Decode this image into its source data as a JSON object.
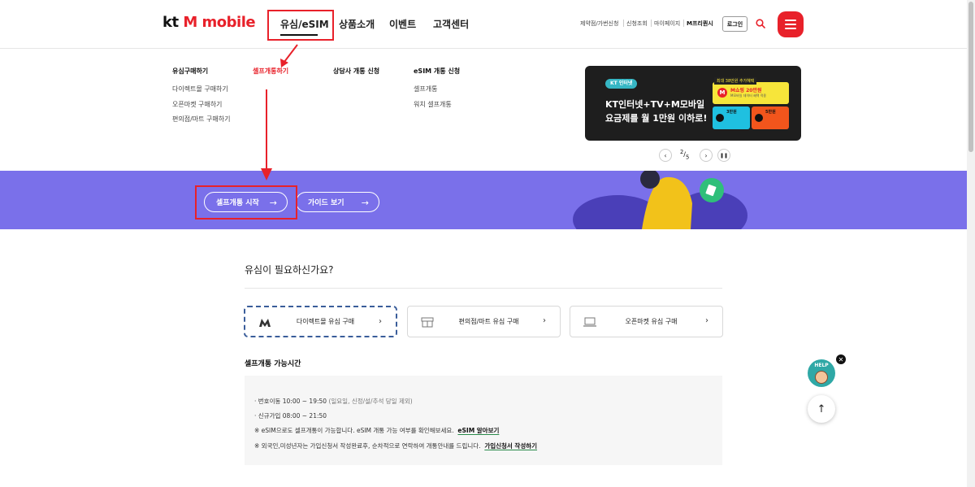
{
  "header": {
    "logo_kt": "kt",
    "logo_brand": "M mobile",
    "gnb": [
      "유심/eSIM",
      "상품소개",
      "이벤트",
      "고객센터"
    ],
    "util": [
      "제약점/가번신청",
      "신청조회",
      "마이페이지",
      "M프리퀀시"
    ],
    "login_label": "로그인"
  },
  "mega_menu": {
    "col1_title": "유심구매하기",
    "col1_items": [
      "다이렉트몰 구매하기",
      "오픈마켓 구매하기",
      "편의점/마트 구매하기"
    ],
    "col2_title": "셀프개통하기",
    "col3_title": "상담사 개통 신청",
    "col4_title": "eSIM 개통 신청",
    "col4_items": [
      "셀프개통",
      "워치 셀프개통"
    ]
  },
  "promo": {
    "badge": "KT 인터넷",
    "line1": "KT인터넷+TV+M모바일",
    "line2": "요금제를 월 1만원 이하로!",
    "top_tag": "최대 38만원 추가혜택",
    "top_text": "M쇼핑 20만원",
    "top_small": "M모바일 데이터 혜택 적용",
    "card_a": "3만원",
    "card_b": "5만원",
    "pager_current": "2",
    "pager_total": "5"
  },
  "hero": {
    "btn_start": "셀프개통 시작",
    "btn_guide": "가이드 보기",
    "bg_color": "#7a70ea"
  },
  "section": {
    "title": "유심이 필요하신가요?",
    "options": [
      "다이렉트몰 유심 구매",
      "편의점/마트 유심 구매",
      "오픈마켓 유심 구매"
    ],
    "hours_title": "셀프개통 가능시간",
    "line1": "번호이동 10:00 ~ 19:50",
    "line1_note": "(일요일, 신정/설/추석 당일 제외)",
    "line2": "신규가입 08:00 ~ 21:50",
    "line3": "※ eSIM으로도 셀프개통이 가능합니다. eSIM 개통 가능 여부를 확인해보세요.",
    "line3_link": "eSIM 알아보기",
    "line4": "※ 외국인,미성년자는 가입신청서 작성완료후, 순차적으로 연락하여 개통안내를 드립니다.",
    "line4_link": "가입신청서 작성하기"
  },
  "floating": {
    "help_label": "HELP"
  },
  "colors": {
    "brand_red": "#e8212a",
    "accent_teal": "#2fa8a6"
  }
}
